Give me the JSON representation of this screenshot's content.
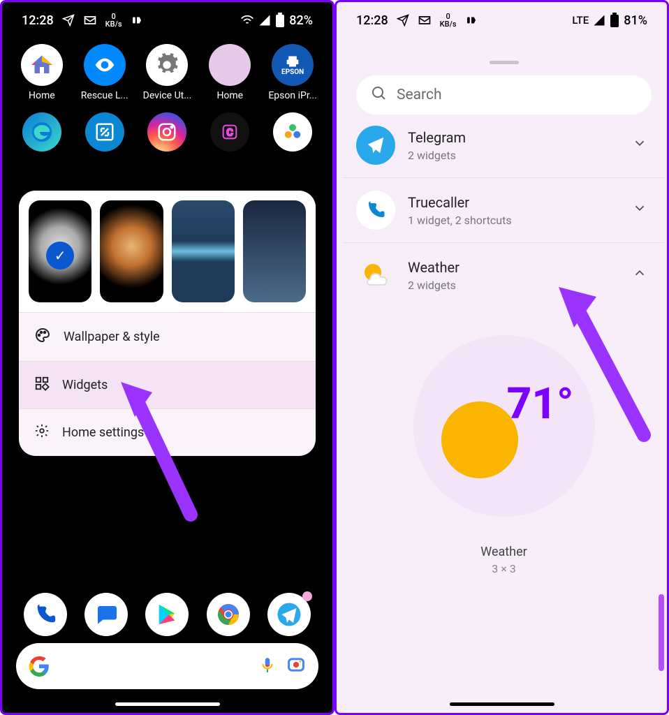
{
  "left": {
    "statusbar": {
      "time": "12:28",
      "speed_top": "0",
      "speed_bot": "KB/s",
      "battery": "82%"
    },
    "apps_row1": [
      {
        "label": "Home"
      },
      {
        "label": "Rescue L..."
      },
      {
        "label": "Device Ut..."
      },
      {
        "label": "Home"
      },
      {
        "label": "Epson iPr..."
      }
    ],
    "menu": {
      "wallpaper_style": "Wallpaper & style",
      "widgets": "Widgets",
      "home_settings": "Home settings"
    }
  },
  "right": {
    "statusbar": {
      "time": "12:28",
      "speed_top": "0",
      "speed_bot": "KB/s",
      "net": "LTE",
      "battery": "81%"
    },
    "search_placeholder": "Search",
    "widget_apps": [
      {
        "title": "Telegram",
        "sub": "2 widgets",
        "expanded": false
      },
      {
        "title": "Truecaller",
        "sub": "1 widget, 2 shortcuts",
        "expanded": false
      },
      {
        "title": "Weather",
        "sub": "2 widgets",
        "expanded": true
      }
    ],
    "preview": {
      "temp": "71°",
      "label": "Weather",
      "size": "3 × 3"
    }
  }
}
